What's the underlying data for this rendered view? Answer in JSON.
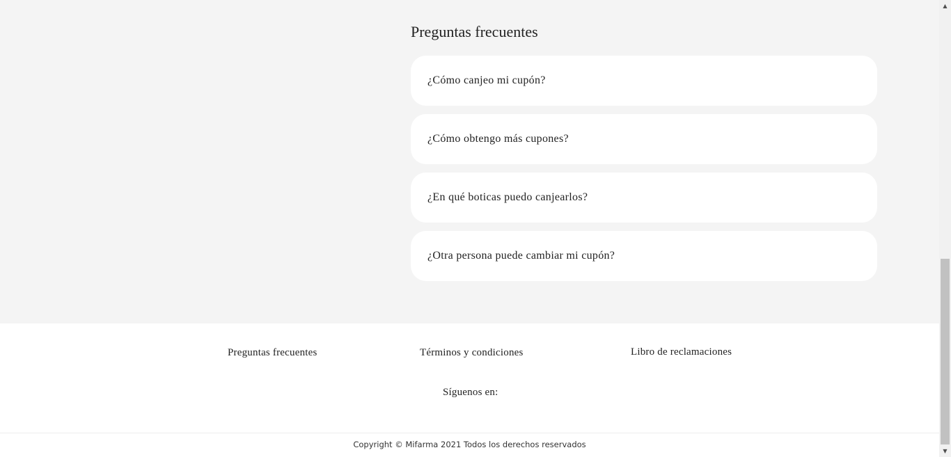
{
  "faq": {
    "title": "Preguntas frecuentes",
    "questions": [
      "¿Cómo canjeo mi cupón?",
      "¿Cómo obtengo más cupones?",
      "¿En qué boticas puedo canjearlos?",
      "¿Otra persona puede cambiar mi cupón?"
    ]
  },
  "footer": {
    "links": {
      "faq": "Preguntas frecuentes",
      "terms": "Términos y condiciones",
      "complaints": "Libro de reclamaciones"
    },
    "follow_label": "Síguenos en:",
    "copyright": "Copyright © Mifarma 2021 Todos los derechos reservados"
  },
  "scrollbar": {
    "up_icon": "▲",
    "down_icon": "▼"
  },
  "colors": {
    "page_background": "#f4f4f4",
    "card_background": "#ffffff",
    "text": "#222222"
  }
}
